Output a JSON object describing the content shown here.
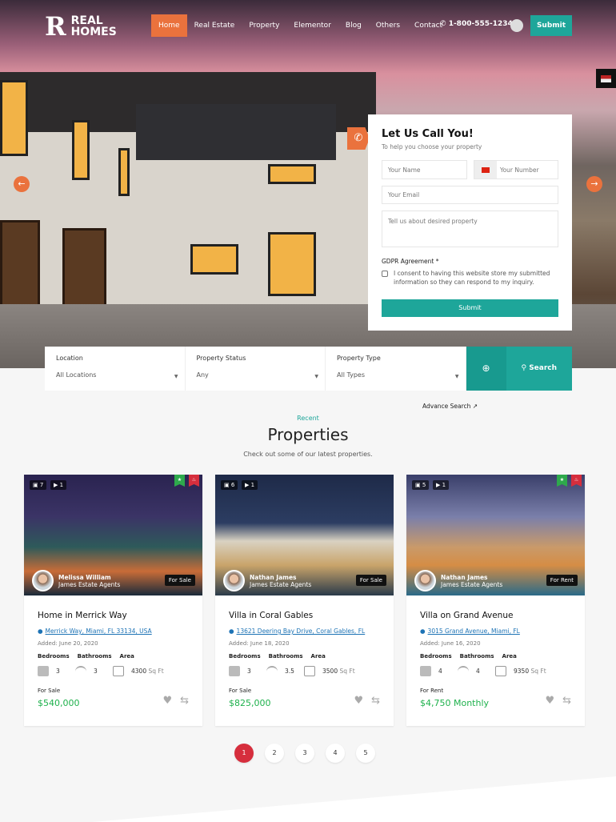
{
  "nav": {
    "logo_mark": "R",
    "logo_line1": "REAL",
    "logo_line2": "HOMES",
    "items": [
      "Home",
      "Real Estate",
      "Property",
      "Elementor",
      "Blog",
      "Others",
      "Contact"
    ],
    "active": "Home",
    "phone": "1-800-555-1234",
    "submit": "Submit"
  },
  "form": {
    "title": "Let Us Call You!",
    "subtitle": "To help you choose your property",
    "name_placeholder": "Your Name",
    "number_placeholder": "Your Number",
    "email_placeholder": "Your Email",
    "message_placeholder": "Tell us about desired property",
    "gdpr_label": "GDPR Agreement *",
    "consent": "I consent to having this website store my submitted information so they can respond to my inquiry.",
    "submit": "Submit"
  },
  "search": {
    "fields": [
      {
        "label": "Location",
        "value": "All Locations"
      },
      {
        "label": "Property Status",
        "value": "Any"
      },
      {
        "label": "Property Type",
        "value": "All Types"
      }
    ],
    "search_label": "Search",
    "advance_label": "Advance Search"
  },
  "section": {
    "kicker": "Recent",
    "title": "Properties",
    "subtitle": "Check out some of our latest properties."
  },
  "labels": {
    "bedrooms": "Bedrooms",
    "bathrooms": "Bathrooms",
    "area": "Area",
    "added": "Added:",
    "area_unit": "Sq Ft"
  },
  "cards": [
    {
      "photos": "7",
      "videos": "1",
      "agent": "Melissa William",
      "agency": "James Estate Agents",
      "status": "For Sale",
      "title": "Home in Merrick Way",
      "address": "Merrick Way, Miami, FL 33134, USA",
      "date": "June 20, 2020",
      "beds": "3",
      "baths": "3",
      "area": "4300",
      "price": "$540,000",
      "featured": true
    },
    {
      "photos": "6",
      "videos": "1",
      "agent": "Nathan James",
      "agency": "James Estate Agents",
      "status": "For Sale",
      "title": "Villa in Coral Gables",
      "address": "13621 Deering Bay Drive, Coral Gables, FL",
      "date": "June 18, 2020",
      "beds": "3",
      "baths": "3.5",
      "area": "3500",
      "price": "$825,000",
      "featured": false
    },
    {
      "photos": "5",
      "videos": "1",
      "agent": "Nathan James",
      "agency": "James Estate Agents",
      "status": "For Rent",
      "title": "Villa on Grand Avenue",
      "address": "3015 Grand Avenue, Miami, FL",
      "date": "June 16, 2020",
      "beds": "4",
      "baths": "4",
      "area": "9350",
      "price": "$4,750 Monthly",
      "featured": true
    }
  ],
  "pagination": [
    "1",
    "2",
    "3",
    "4",
    "5"
  ],
  "colors": {
    "accent": "#1ea69a",
    "orange": "#ea723d",
    "price": "#1eb14c",
    "active_page": "#d62e3d"
  }
}
